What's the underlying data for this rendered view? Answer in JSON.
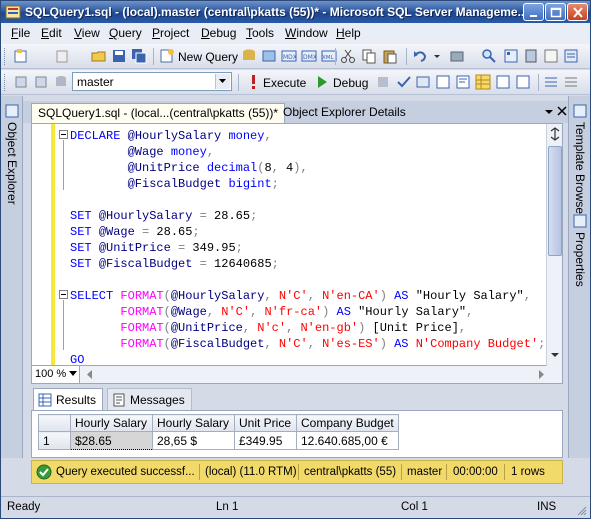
{
  "window": {
    "title": "SQLQuery1.sql - (local).master (central\\pkatts (55))* - Microsoft SQL Server Manageme..."
  },
  "menu": {
    "items": [
      {
        "label": "File",
        "u": "F",
        "rest": "ile"
      },
      {
        "label": "Edit",
        "u": "E",
        "rest": "dit"
      },
      {
        "label": "View",
        "u": "V",
        "rest": "iew"
      },
      {
        "label": "Query",
        "u": "Q",
        "rest": "uery"
      },
      {
        "label": "Project",
        "u": "P",
        "rest": "roject"
      },
      {
        "label": "Debug",
        "u": "D",
        "rest": "ebug"
      },
      {
        "label": "Tools",
        "u": "T",
        "rest": "ools"
      },
      {
        "label": "Window",
        "u": "W",
        "rest": "indow"
      },
      {
        "label": "Help",
        "u": "H",
        "rest": "elp"
      }
    ]
  },
  "toolbar1": {
    "new_query_label": "New Query"
  },
  "toolbar2": {
    "database": "master",
    "execute_label": "Execute",
    "debug_label": "Debug"
  },
  "side": {
    "left_panel": "Object Explorer",
    "right_panel_1": "Template Browser",
    "right_panel_2": "Properties"
  },
  "tabs": {
    "active": "SQLQuery1.sql - (local...(central\\pkatts (55))*",
    "inactive": "Object Explorer Details"
  },
  "editor": {
    "zoom": "100 %",
    "lines": [
      "DECLARE @HourlySalary money,",
      "        @Wage money,",
      "        @UnitPrice decimal(8, 4),",
      "        @FiscalBudget bigint;",
      "",
      "SET @HourlySalary = 28.65;",
      "SET @Wage = 28.65;",
      "SET @UnitPrice = 349.95;",
      "SET @FiscalBudget = 12640685;",
      "",
      "SELECT FORMAT(@HourlySalary, N'C', N'en-CA') AS \"Hourly Salary\",",
      "       FORMAT(@Wage, N'C', N'fr-ca') AS \"Hourly Salary\",",
      "       FORMAT(@UnitPrice, N'c', N'en-gb') [Unit Price],",
      "       FORMAT(@FiscalBudget, N'C', N'es-ES') AS N'Company Budget';",
      "GO"
    ]
  },
  "results": {
    "tab_results": "Results",
    "tab_messages": "Messages",
    "columns": [
      "Hourly Salary",
      "Hourly Salary",
      "Unit Price",
      "Company Budget"
    ],
    "rows": [
      {
        "num": "1",
        "cells": [
          "$28.65",
          "28,65 $",
          "£349.95",
          "12.640.685,00 €"
        ]
      }
    ]
  },
  "query_status": {
    "message": "Query executed successf...",
    "server": "(local) (11.0 RTM)",
    "user": "central\\pkatts (55)",
    "database": "master",
    "elapsed": "00:00:00",
    "rows": "1 rows"
  },
  "statusbar": {
    "state": "Ready",
    "line": "Ln 1",
    "col": "Col 1",
    "mode": "INS"
  },
  "colors": {
    "status_strip": "#f1da6a",
    "keyword": "#0000ff",
    "function": "#ff00ff",
    "string": "#ff0000"
  }
}
